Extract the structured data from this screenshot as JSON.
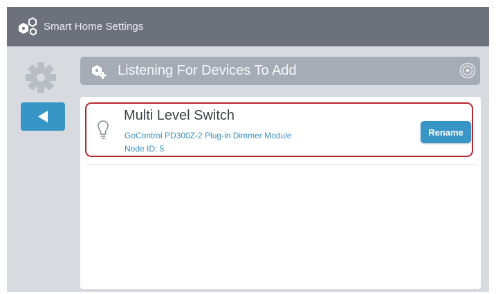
{
  "titlebar": {
    "title": "Smart Home Settings",
    "icon": "smart-home-hex-icon"
  },
  "sidebar": {
    "settings_icon": "gear-icon",
    "back_icon": "back-arrow-icon"
  },
  "listening_bar": {
    "label": "Listening For Devices To Add",
    "icon": "add-device-icon",
    "spinner_icon": "scanning-spinner-icon"
  },
  "devices": [
    {
      "name": "Multi Level Switch",
      "model": "GoControl PD300Z-2 Plug-in Dimmer Module",
      "node": "Node ID: 5",
      "icon": "lightbulb-icon",
      "rename_label": "Rename",
      "selected": true
    }
  ],
  "colors": {
    "titlebar": "#6c717b",
    "background": "#d7dadf",
    "accent": "#3896c6",
    "selection_border": "#b8262e",
    "listening_bar": "#a6acb6"
  }
}
